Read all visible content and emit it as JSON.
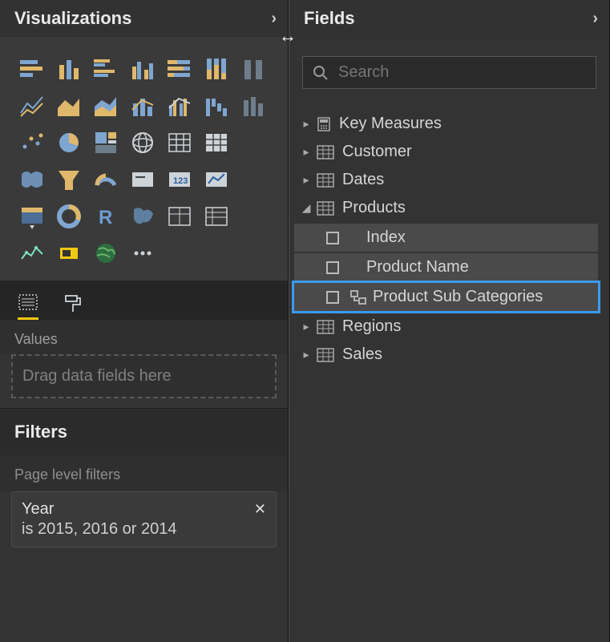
{
  "panels": {
    "visualizations": {
      "title": "Visualizations",
      "collapse_arrow": "›"
    },
    "fields": {
      "title": "Fields",
      "collapse_arrow": "›"
    }
  },
  "resize_arrow": "↔",
  "viz_icons": [
    "stacked-bar",
    "stacked-column",
    "clustered-bar",
    "clustered-column",
    "100-stacked-bar",
    "100-stacked-column",
    "ribbon",
    "line",
    "area",
    "stacked-area",
    "line-stacked-column",
    "line-clustered-column",
    "waterfall",
    "scatter",
    "scatter2",
    "pie",
    "treemap",
    "globe",
    "table",
    "matrix",
    "blank1",
    "filled-map",
    "funnel",
    "gauge",
    "card",
    "multi-card",
    "kpi",
    "blank2",
    "slicer",
    "donut",
    "r-visual",
    "shape-map",
    "table2",
    "matrix2",
    "blank3",
    "key-influencers",
    "decomposition",
    "arcgis",
    "more",
    "",
    "",
    ""
  ],
  "tabs": {
    "fields_tab": "Fields",
    "format_tab": "Format"
  },
  "values": {
    "label": "Values",
    "placeholder": "Drag data fields here"
  },
  "filters": {
    "title": "Filters",
    "page_level_label": "Page level filters",
    "card": {
      "field": "Year",
      "summary": "is 2015, 2016 or 2014"
    }
  },
  "search": {
    "placeholder": "Search"
  },
  "tables": [
    {
      "name": "Key Measures",
      "expanded": false,
      "icon": "calc"
    },
    {
      "name": "Customer",
      "expanded": false,
      "icon": "table"
    },
    {
      "name": "Dates",
      "expanded": false,
      "icon": "table"
    },
    {
      "name": "Products",
      "expanded": true,
      "icon": "table",
      "fields": [
        {
          "name": "Index",
          "selected": false,
          "hierarchy": false
        },
        {
          "name": "Product Name",
          "selected": false,
          "hierarchy": false
        },
        {
          "name": "Product Sub Categories",
          "selected": false,
          "hierarchy": true,
          "highlighted": true
        }
      ]
    },
    {
      "name": "Regions",
      "expanded": false,
      "icon": "table"
    },
    {
      "name": "Sales",
      "expanded": false,
      "icon": "table"
    }
  ]
}
